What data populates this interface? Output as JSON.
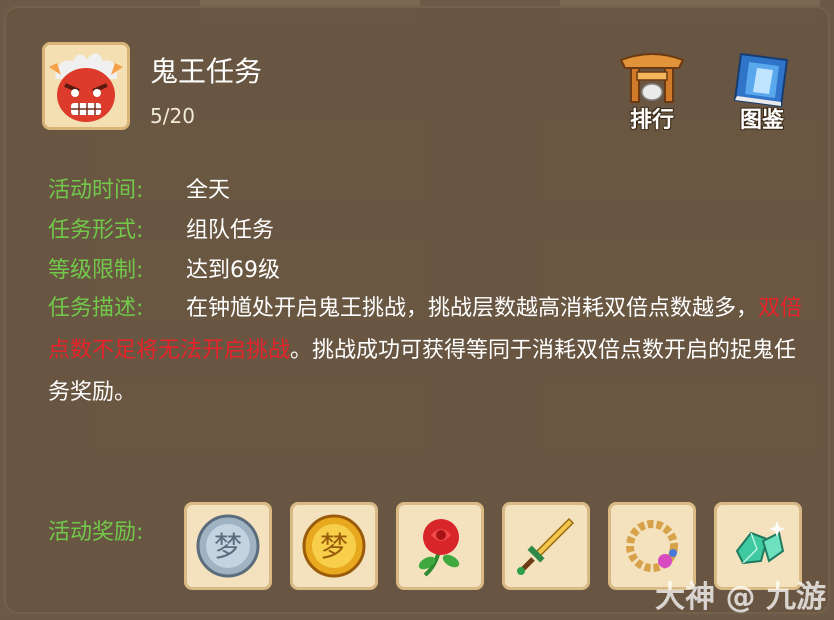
{
  "task": {
    "title": "鬼王任务",
    "progress": "5/20"
  },
  "top_buttons": {
    "ranking_label": "排行",
    "handbook_label": "图鉴"
  },
  "details": {
    "time_key": "活动时间:",
    "time_value": "全天",
    "form_key": "任务形式:",
    "form_value": "组队任务",
    "level_key": "等级限制:",
    "level_value": "达到69级",
    "desc_key": "任务描述:",
    "desc_part1": "在钟馗处开启鬼王挑战，挑战层数越高消耗双倍点数越多，",
    "desc_warning": "双倍点数不足将无法开启挑战",
    "desc_part2": "。挑战成功可获得等同于消耗双倍点数开启的捉鬼任务奖励。"
  },
  "rewards": {
    "label": "活动奖励:",
    "items": [
      {
        "name": "silver-dream-coin-icon"
      },
      {
        "name": "gold-dream-coin-icon"
      },
      {
        "name": "rose-icon"
      },
      {
        "name": "sword-icon"
      },
      {
        "name": "bead-bracelet-icon"
      },
      {
        "name": "jade-crystal-icon"
      }
    ]
  },
  "watermark": {
    "text": "大神 @ 九游"
  },
  "colors": {
    "panel": "#685642",
    "key_green": "#72c84a",
    "warning_red": "#e8232a",
    "slot_bg": "#f3e2bd"
  }
}
